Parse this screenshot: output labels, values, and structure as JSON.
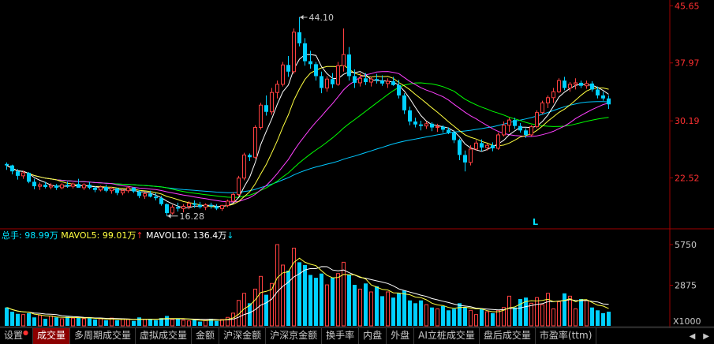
{
  "chart_data": [
    {
      "type": "candlestick",
      "price_axis_ticks": [
        "45.65",
        "37.97",
        "30.19",
        "22.52"
      ],
      "price_range": [
        16,
        46
      ],
      "annotations": {
        "high_label": "44.10",
        "low_label": "16.28",
        "marker_letter": "L"
      },
      "colors": {
        "up": "#ff4040",
        "down": "#00d0ff",
        "ma5": "#ffffff",
        "ma10": "#ffff40",
        "ma20": "#ff40ff",
        "ma30": "#00ff00",
        "ma60": "#00c8ff",
        "axis_text": "#ff3030",
        "frame": "#a00000"
      },
      "ohlc": [
        [
          24.4,
          24.6,
          23.6,
          24.2
        ],
        [
          24.2,
          24.3,
          23.0,
          23.4
        ],
        [
          23.4,
          23.7,
          22.3,
          22.8
        ],
        [
          22.8,
          23.5,
          22.4,
          23.2
        ],
        [
          23.2,
          23.3,
          21.8,
          22.0
        ],
        [
          22.0,
          22.4,
          21.0,
          21.4
        ],
        [
          21.4,
          21.9,
          20.9,
          21.6
        ],
        [
          21.6,
          22.0,
          21.1,
          21.3
        ],
        [
          21.3,
          21.8,
          21.0,
          21.5
        ],
        [
          21.5,
          21.7,
          20.9,
          21.2
        ],
        [
          21.2,
          21.8,
          21.0,
          21.6
        ],
        [
          21.6,
          22.0,
          21.2,
          21.4
        ],
        [
          21.4,
          21.9,
          21.1,
          21.7
        ],
        [
          21.7,
          22.4,
          21.3,
          21.2
        ],
        [
          21.2,
          21.8,
          20.9,
          21.6
        ],
        [
          21.6,
          22.0,
          21.0,
          21.2
        ],
        [
          21.2,
          21.4,
          20.6,
          20.9
        ],
        [
          20.9,
          21.5,
          20.7,
          21.3
        ],
        [
          21.3,
          21.6,
          20.6,
          20.8
        ],
        [
          20.8,
          21.3,
          20.4,
          21.1
        ],
        [
          21.1,
          21.2,
          20.2,
          20.5
        ],
        [
          20.5,
          21.0,
          20.2,
          20.8
        ],
        [
          20.8,
          21.4,
          20.5,
          21.2
        ],
        [
          21.2,
          21.3,
          20.5,
          20.7
        ],
        [
          20.7,
          20.9,
          19.8,
          20.1
        ],
        [
          20.1,
          20.6,
          19.7,
          20.4
        ],
        [
          20.4,
          20.8,
          19.9,
          20.0
        ],
        [
          20.0,
          20.5,
          19.5,
          19.8
        ],
        [
          19.8,
          20.1,
          18.8,
          19.0
        ],
        [
          19.0,
          19.1,
          17.4,
          17.8
        ],
        [
          17.8,
          18.9,
          17.6,
          18.6
        ],
        [
          18.6,
          19.2,
          18.0,
          18.4
        ],
        [
          18.4,
          19.0,
          17.9,
          18.7
        ],
        [
          18.7,
          19.4,
          18.3,
          19.1
        ],
        [
          19.1,
          19.5,
          18.5,
          18.9
        ],
        [
          18.9,
          19.3,
          18.4,
          18.6
        ],
        [
          18.6,
          19.1,
          18.2,
          18.9
        ],
        [
          18.9,
          19.2,
          18.4,
          18.7
        ],
        [
          18.7,
          19.0,
          18.2,
          18.4
        ],
        [
          18.4,
          18.9,
          18.1,
          18.8
        ],
        [
          18.8,
          19.6,
          18.6,
          19.4
        ],
        [
          19.4,
          20.6,
          19.3,
          20.3
        ],
        [
          20.3,
          22.8,
          20.1,
          22.5
        ],
        [
          22.5,
          25.9,
          22.2,
          25.6
        ],
        [
          25.6,
          25.8,
          24.8,
          25.3
        ],
        [
          25.3,
          29.6,
          25.1,
          29.3
        ],
        [
          29.3,
          32.6,
          29.0,
          32.3
        ],
        [
          32.3,
          33.6,
          30.9,
          31.4
        ],
        [
          31.4,
          34.6,
          31.0,
          34.0
        ],
        [
          34.0,
          35.6,
          33.2,
          35.1
        ],
        [
          35.1,
          38.1,
          34.8,
          37.7
        ],
        [
          37.7,
          38.9,
          36.1,
          36.8
        ],
        [
          36.8,
          42.6,
          36.5,
          42.1
        ],
        [
          42.1,
          44.1,
          40.2,
          40.6
        ],
        [
          40.6,
          41.3,
          37.6,
          38.2
        ],
        [
          38.2,
          39.6,
          37.2,
          37.8
        ],
        [
          37.8,
          38.1,
          35.6,
          36.2
        ],
        [
          36.2,
          36.8,
          33.9,
          34.6
        ],
        [
          34.6,
          36.2,
          34.1,
          35.8
        ],
        [
          35.8,
          36.6,
          34.6,
          35.1
        ],
        [
          35.1,
          38.1,
          34.9,
          37.6
        ],
        [
          37.6,
          42.6,
          36.8,
          39.1
        ],
        [
          39.1,
          40.1,
          35.6,
          36.2
        ],
        [
          36.2,
          37.1,
          34.6,
          35.3
        ],
        [
          35.3,
          36.6,
          34.8,
          35.9
        ],
        [
          35.9,
          36.6,
          35.0,
          35.4
        ],
        [
          35.4,
          36.1,
          34.8,
          35.8
        ],
        [
          35.8,
          36.5,
          35.2,
          35.6
        ],
        [
          35.6,
          36.3,
          34.9,
          35.2
        ],
        [
          35.2,
          35.9,
          34.6,
          35.5
        ],
        [
          35.5,
          36.1,
          34.9,
          35.0
        ],
        [
          35.0,
          35.7,
          33.2,
          33.6
        ],
        [
          33.6,
          33.9,
          31.1,
          31.6
        ],
        [
          31.6,
          32.1,
          29.6,
          30.1
        ],
        [
          30.1,
          30.6,
          29.3,
          29.7
        ],
        [
          29.7,
          30.2,
          28.9,
          29.5
        ],
        [
          29.5,
          30.1,
          29.1,
          29.8
        ],
        [
          29.8,
          30.0,
          28.8,
          29.3
        ],
        [
          29.3,
          29.8,
          28.7,
          29.4
        ],
        [
          29.4,
          29.6,
          28.6,
          29.0
        ],
        [
          29.0,
          29.3,
          28.4,
          28.6
        ],
        [
          28.6,
          28.9,
          27.2,
          27.6
        ],
        [
          27.6,
          27.8,
          24.9,
          25.6
        ],
        [
          25.6,
          26.2,
          23.4,
          24.6
        ],
        [
          24.6,
          26.9,
          24.2,
          26.4
        ],
        [
          26.4,
          27.6,
          26.2,
          27.2
        ],
        [
          27.2,
          27.7,
          26.1,
          26.6
        ],
        [
          26.6,
          27.1,
          26.2,
          26.9
        ],
        [
          26.9,
          27.3,
          26.1,
          26.5
        ],
        [
          26.5,
          28.6,
          26.3,
          28.3
        ],
        [
          28.3,
          30.1,
          28.1,
          29.6
        ],
        [
          29.6,
          30.6,
          28.7,
          30.3
        ],
        [
          30.3,
          30.6,
          29.1,
          29.5
        ],
        [
          29.5,
          29.9,
          28.6,
          28.9
        ],
        [
          28.9,
          29.2,
          27.9,
          28.3
        ],
        [
          28.3,
          29.6,
          28.1,
          29.4
        ],
        [
          29.4,
          31.6,
          29.2,
          31.3
        ],
        [
          31.3,
          32.9,
          31.1,
          32.6
        ],
        [
          32.6,
          33.6,
          31.9,
          33.3
        ],
        [
          33.3,
          34.6,
          32.6,
          34.1
        ],
        [
          34.1,
          35.9,
          33.9,
          35.6
        ],
        [
          35.6,
          36.1,
          34.3,
          34.6
        ],
        [
          34.6,
          35.4,
          34.1,
          35.1
        ],
        [
          35.1,
          35.9,
          34.4,
          35.3
        ],
        [
          35.3,
          35.6,
          34.6,
          34.9
        ],
        [
          34.9,
          35.6,
          34.5,
          35.2
        ],
        [
          35.2,
          35.5,
          34.1,
          34.4
        ],
        [
          34.4,
          34.8,
          33.2,
          33.6
        ],
        [
          33.6,
          34.1,
          32.9,
          33.2
        ],
        [
          33.2,
          33.6,
          31.8,
          32.4
        ]
      ]
    },
    {
      "type": "bar",
      "title": "总手",
      "legend": [
        {
          "name": "总手",
          "value": "98.99万",
          "color": "#00e5ff",
          "arrow": ""
        },
        {
          "name": "MAVOL5",
          "value": "99.01万",
          "color": "#ffff40",
          "arrow": "↑",
          "arrow_color": "#ff3030"
        },
        {
          "name": "MAVOL10",
          "value": "136.4万",
          "color": "#ffffff",
          "arrow": "↓",
          "arrow_color": "#00e5ff"
        }
      ],
      "axis_ticks": [
        "5750",
        "2875"
      ],
      "unit_label": "X1000",
      "ylim": [
        0,
        5750
      ],
      "volume": [
        1300,
        1000,
        850,
        800,
        900,
        600,
        750,
        500,
        700,
        600,
        500,
        650,
        550,
        600,
        500,
        550,
        450,
        500,
        400,
        550,
        400,
        500,
        450,
        350,
        600,
        450,
        500,
        400,
        550,
        700,
        450,
        500,
        400,
        350,
        450,
        300,
        400,
        500,
        350,
        450,
        600,
        900,
        1800,
        2300,
        1600,
        2600,
        3500,
        2200,
        3000,
        5750,
        4300,
        3900,
        5500,
        4500,
        4300,
        3600,
        3400,
        3700,
        2900,
        3400,
        3700,
        4500,
        3600,
        2900,
        2600,
        3000,
        2400,
        2800,
        2100,
        2400,
        2000,
        2300,
        2500,
        1800,
        1600,
        1800,
        1500,
        1300,
        1200,
        1400,
        1100,
        1200,
        1600,
        1300,
        1100,
        800,
        1200,
        1000,
        900,
        1100,
        1300,
        2100,
        1300,
        1900,
        2000,
        1600,
        2000,
        1500,
        2300,
        1200,
        1700,
        2300,
        2100,
        1200,
        1900,
        1800,
        1300,
        1100,
        900,
        1000
      ]
    }
  ],
  "tabs": [
    {
      "label": "设置",
      "active": false,
      "dot": true
    },
    {
      "label": "成交量",
      "active": true,
      "dot": false
    },
    {
      "label": "多周期成交量",
      "active": false,
      "dot": false
    },
    {
      "label": "虚拟成交量",
      "active": false,
      "dot": false
    },
    {
      "label": "金额",
      "active": false,
      "dot": false
    },
    {
      "label": "沪深金额",
      "active": false,
      "dot": false
    },
    {
      "label": "沪深京金额",
      "active": false,
      "dot": false
    },
    {
      "label": "换手率",
      "active": false,
      "dot": false
    },
    {
      "label": "内盘",
      "active": false,
      "dot": false
    },
    {
      "label": "外盘",
      "active": false,
      "dot": false
    },
    {
      "label": "AI立桩成交量",
      "active": false,
      "dot": false
    },
    {
      "label": "盘后成交量",
      "active": false,
      "dot": false
    },
    {
      "label": "市盈率(ttm)",
      "active": false,
      "dot": false
    }
  ],
  "nav_icons": [
    "arrow-left-icon",
    "arrow-right-icon"
  ]
}
